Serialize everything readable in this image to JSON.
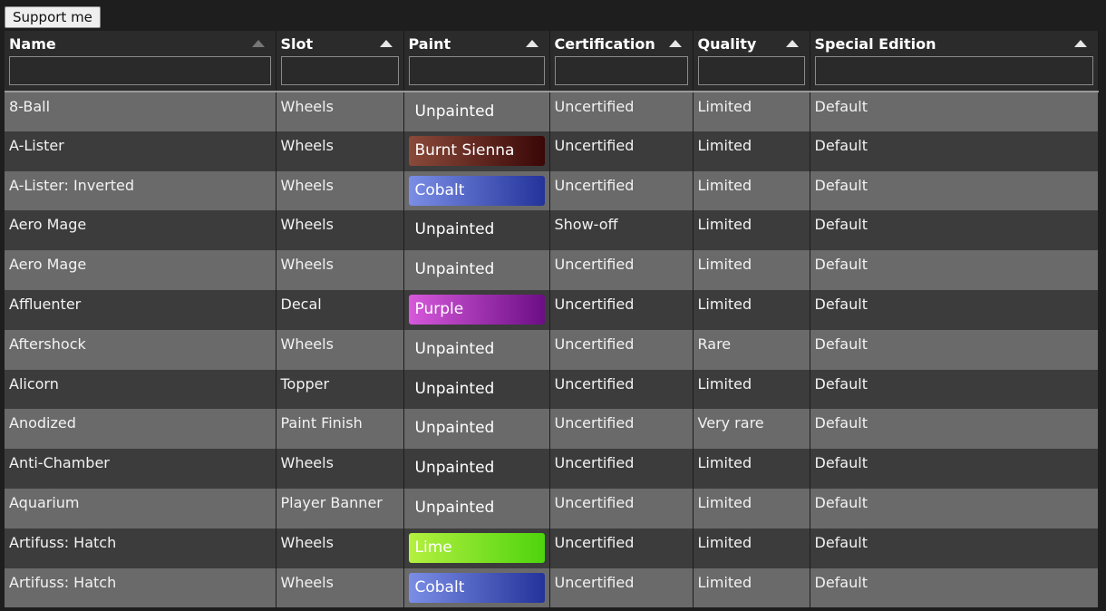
{
  "support_label": "Support me",
  "columns": [
    {
      "label": "Name",
      "dim": true
    },
    {
      "label": "Slot",
      "dim": false
    },
    {
      "label": "Paint",
      "dim": false
    },
    {
      "label": "Certification",
      "dim": false
    },
    {
      "label": "Quality",
      "dim": false
    },
    {
      "label": "Special Edition",
      "dim": false
    }
  ],
  "paint_colors": {
    "Burnt Sienna": "burnt",
    "Cobalt": "cobalt",
    "Purple": "purple",
    "Lime": "lime",
    "Unpainted": "unpainted"
  },
  "rows": [
    {
      "name": "8-Ball",
      "slot": "Wheels",
      "paint": "Unpainted",
      "cert": "Uncertified",
      "quality": "Limited",
      "special": "Default"
    },
    {
      "name": "A-Lister",
      "slot": "Wheels",
      "paint": "Burnt Sienna",
      "cert": "Uncertified",
      "quality": "Limited",
      "special": "Default"
    },
    {
      "name": "A-Lister: Inverted",
      "slot": "Wheels",
      "paint": "Cobalt",
      "cert": "Uncertified",
      "quality": "Limited",
      "special": "Default"
    },
    {
      "name": "Aero Mage",
      "slot": "Wheels",
      "paint": "Unpainted",
      "cert": "Show-off",
      "quality": "Limited",
      "special": "Default"
    },
    {
      "name": "Aero Mage",
      "slot": "Wheels",
      "paint": "Unpainted",
      "cert": "Uncertified",
      "quality": "Limited",
      "special": "Default"
    },
    {
      "name": "Affluenter",
      "slot": "Decal",
      "paint": "Purple",
      "cert": "Uncertified",
      "quality": "Limited",
      "special": "Default"
    },
    {
      "name": "Aftershock",
      "slot": "Wheels",
      "paint": "Unpainted",
      "cert": "Uncertified",
      "quality": "Rare",
      "special": "Default"
    },
    {
      "name": "Alicorn",
      "slot": "Topper",
      "paint": "Unpainted",
      "cert": "Uncertified",
      "quality": "Limited",
      "special": "Default"
    },
    {
      "name": "Anodized",
      "slot": "Paint Finish",
      "paint": "Unpainted",
      "cert": "Uncertified",
      "quality": "Very rare",
      "special": "Default"
    },
    {
      "name": "Anti-Chamber",
      "slot": "Wheels",
      "paint": "Unpainted",
      "cert": "Uncertified",
      "quality": "Limited",
      "special": "Default"
    },
    {
      "name": "Aquarium",
      "slot": "Player Banner",
      "paint": "Unpainted",
      "cert": "Uncertified",
      "quality": "Limited",
      "special": "Default"
    },
    {
      "name": "Artifuss: Hatch",
      "slot": "Wheels",
      "paint": "Lime",
      "cert": "Uncertified",
      "quality": "Limited",
      "special": "Default"
    },
    {
      "name": "Artifuss: Hatch",
      "slot": "Wheels",
      "paint": "Cobalt",
      "cert": "Uncertified",
      "quality": "Limited",
      "special": "Default"
    }
  ]
}
